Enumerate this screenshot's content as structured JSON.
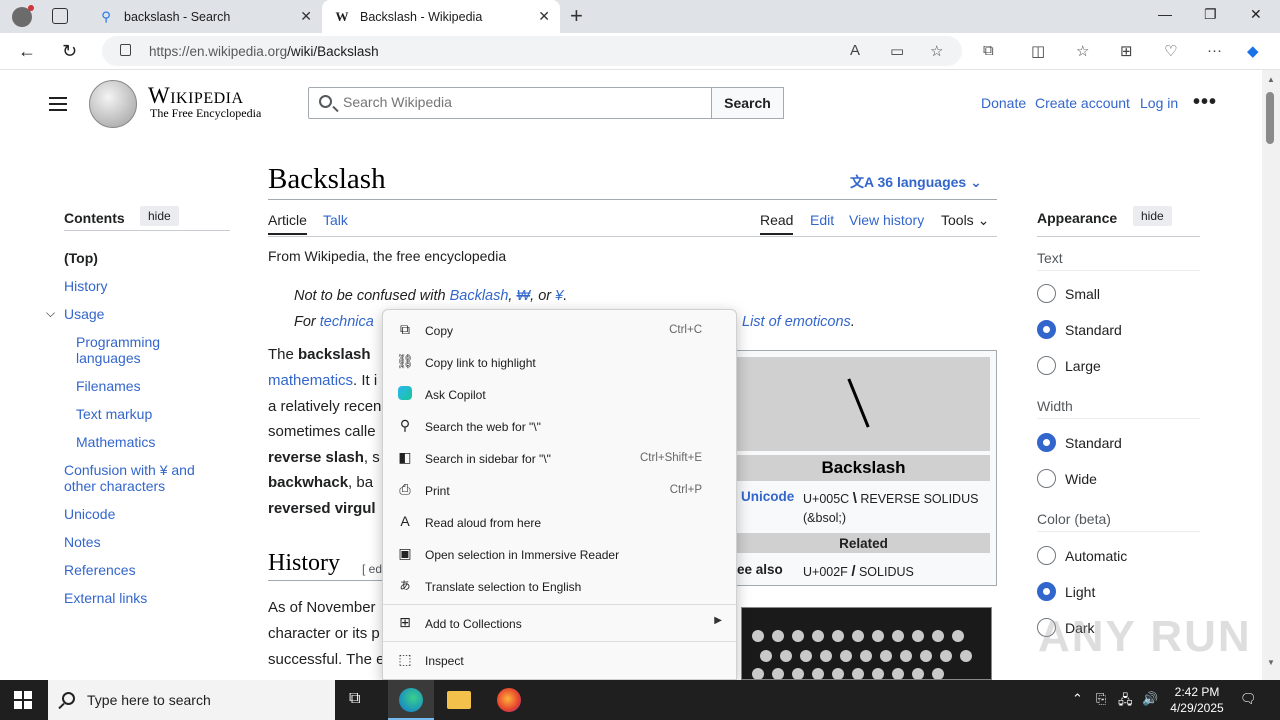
{
  "browser": {
    "tabs": [
      {
        "title": "backslash - Search",
        "icon": "search-icon"
      },
      {
        "title": "Backslash - Wikipedia",
        "icon": "wikipedia-w-icon"
      }
    ],
    "url_host": "https://en.wikipedia.org",
    "url_path": "/wiki/Backslash"
  },
  "wiki": {
    "wordmark": "Wikipedia",
    "tagline": "The Free Encyclopedia",
    "search_placeholder": "Search Wikipedia",
    "search_button": "Search",
    "header_links": [
      "Donate",
      "Create account",
      "Log in"
    ],
    "more": "•••"
  },
  "toc": {
    "title": "Contents",
    "hide": "hide",
    "items": [
      "(Top)",
      "History",
      "Usage",
      "Programming languages",
      "Filenames",
      "Text markup",
      "Mathematics",
      "Confusion with ¥ and other characters",
      "Unicode",
      "Notes",
      "References",
      "External links"
    ]
  },
  "article": {
    "title": "Backslash",
    "languages": "36 languages",
    "tabs": [
      "Article",
      "Talk"
    ],
    "actions": [
      "Read",
      "Edit",
      "View history",
      "Tools"
    ],
    "from": "From Wikipedia, the free encyclopedia",
    "hatnote1_prefix": "Not to be confused with ",
    "hatnote1_link": "Backlash",
    "hatnote1_rest1": ", ",
    "hatnote1_won": "₩",
    "hatnote1_rest2": ", or ",
    "hatnote1_yen": "¥",
    "hatnote1_end": ".",
    "hatnote2_prefix": "For ",
    "hatnote2_link": "technica",
    "hatnote2_link2": "List of emoticons",
    "hatnote2_end": ".",
    "lines": {
      "l1_pre": "The ",
      "l1_bold": "backslash",
      "l2": "mathematics",
      "l2b": ". It i",
      "l3": "a relatively recen",
      "l4": "sometimes calle",
      "l5": "reverse slash",
      "l5b": ", s",
      "l6": "backwhack",
      "l6b": ", ba",
      "l7": "reversed virgul"
    },
    "history_heading": "History",
    "history_edit": "[ ed",
    "history_lines": [
      "As of November",
      "character or its p",
      "successful. The e"
    ]
  },
  "infobox": {
    "name": "Backslash",
    "unicode_label": "Unicode",
    "unicode_value": "U+005C",
    "unicode_glyph": "\\",
    "unicode_name": "REVERSE SOLIDUS",
    "unicode_entity": "(&bsol;)",
    "related": "Related",
    "see_also_label": "ee also",
    "see_also_value": "U+002F",
    "see_also_glyph": "/",
    "see_also_name": "SOLIDUS"
  },
  "appearance": {
    "title": "Appearance",
    "hide": "hide",
    "text_label": "Text",
    "text_options": [
      "Small",
      "Standard",
      "Large"
    ],
    "text_selected": "Standard",
    "width_label": "Width",
    "width_options": [
      "Standard",
      "Wide"
    ],
    "width_selected": "Standard",
    "color_label": "Color (beta)",
    "color_options": [
      "Automatic",
      "Light",
      "Dark"
    ],
    "color_selected": "Light"
  },
  "context_menu": {
    "items": [
      {
        "label": "Copy",
        "shortcut": "Ctrl+C",
        "icon": "copy-icon"
      },
      {
        "label": "Copy link to highlight",
        "shortcut": "",
        "icon": "link-highlight-icon"
      },
      {
        "label": "Ask Copilot",
        "shortcut": "",
        "icon": "copilot-icon"
      },
      {
        "label": "Search the web for \"\\\"",
        "shortcut": "",
        "icon": "search-icon"
      },
      {
        "label": "Search in sidebar for \"\\\"",
        "shortcut": "Ctrl+Shift+E",
        "icon": "sidebar-search-icon"
      },
      {
        "label": "Print",
        "shortcut": "Ctrl+P",
        "icon": "print-icon"
      },
      {
        "label": "Read aloud from here",
        "shortcut": "",
        "icon": "read-aloud-icon"
      },
      {
        "label": "Open selection in Immersive Reader",
        "shortcut": "",
        "icon": "immersive-reader-icon"
      },
      {
        "label": "Translate selection to English",
        "shortcut": "",
        "icon": "translate-icon"
      },
      {
        "label": "Add to Collections",
        "shortcut": "",
        "icon": "collections-icon"
      },
      {
        "label": "Inspect",
        "shortcut": "",
        "icon": "inspect-icon"
      }
    ]
  },
  "watermark": "ANY RUN",
  "taskbar": {
    "search_placeholder": "Type here to search",
    "time": "2:42 PM",
    "date": "4/29/2025"
  }
}
